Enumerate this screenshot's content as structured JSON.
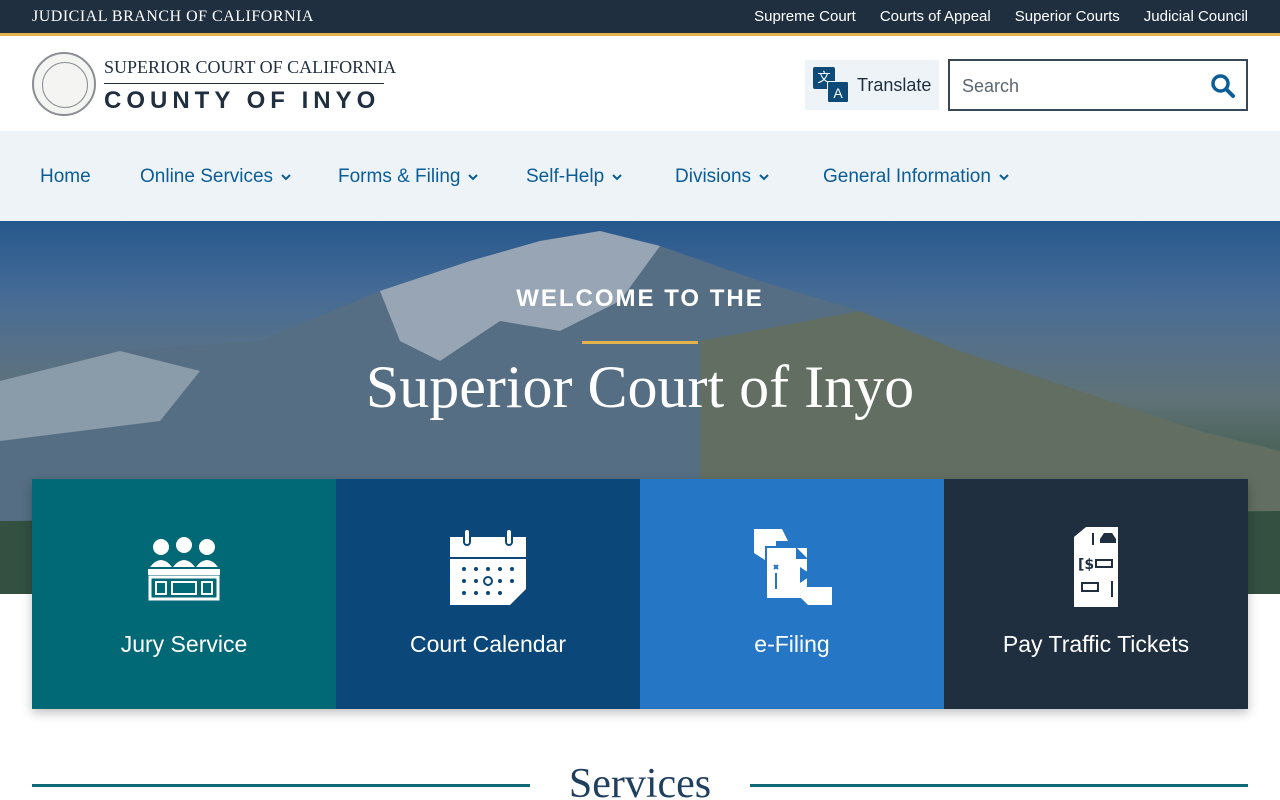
{
  "topbar": {
    "branch": "JUDICIAL BRANCH OF CALIFORNIA",
    "links": [
      "Supreme Court",
      "Courts of Appeal",
      "Superior Courts",
      "Judicial Council"
    ]
  },
  "header": {
    "court_top": "SUPERIOR COURT OF CALIFORNIA",
    "court_bottom": "COUNTY OF INYO",
    "translate_label": "Translate",
    "search_placeholder": "Search"
  },
  "nav": {
    "items": [
      "Home",
      "Online Services",
      "Forms & Filing",
      "Self-Help",
      "Divisions",
      "General Information"
    ]
  },
  "hero": {
    "welcome": "WELCOME TO THE",
    "title": "Superior Court of Inyo"
  },
  "tiles": [
    {
      "label": "Jury Service",
      "color": "#006975",
      "icon": "jury-icon"
    },
    {
      "label": "Court Calendar",
      "color": "#0b4778",
      "icon": "calendar-icon"
    },
    {
      "label": "e-Filing",
      "color": "#2676c6",
      "icon": "efiling-icon"
    },
    {
      "label": "Pay Traffic Tickets",
      "color": "#1f2f40",
      "icon": "ticket-icon"
    }
  ],
  "services": {
    "heading": "Services"
  },
  "colors": {
    "topbar": "#1f2f40",
    "accent_gold": "#e3b24a",
    "nav_bg": "#eef3f8",
    "nav_text": "#0b5d97"
  }
}
